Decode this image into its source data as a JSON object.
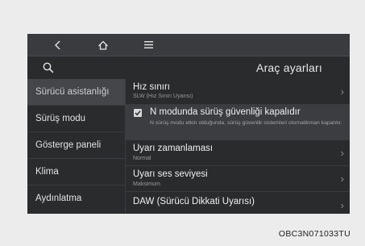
{
  "nav": {
    "back_icon": "chevron-left-icon",
    "home_icon": "home-icon",
    "menu_icon": "menu-icon"
  },
  "header": {
    "search_icon": "search-icon",
    "title": "Araç ayarları"
  },
  "sidebar": {
    "items": [
      {
        "label": "Sürücü asistanlığı",
        "active": true
      },
      {
        "label": "Sürüş modu",
        "active": false
      },
      {
        "label": "Gösterge paneli",
        "active": false
      },
      {
        "label": "Klima",
        "active": false
      },
      {
        "label": "Aydınlatma",
        "active": false
      }
    ]
  },
  "settings": {
    "speed_limit": {
      "label": "Hız sınırı",
      "value": "SLW (Hız Sınırı Uyarısı)"
    },
    "n_mode": {
      "label": "N modunda sürüş güvenliği kapalıdır",
      "checked": true,
      "description": "N sürüş modu etkin olduğunda, sürüş güvenlik sistemleri otomatikman kapatılır."
    },
    "warning_timing": {
      "label": "Uyarı zamanlaması",
      "value": "Normal"
    },
    "warning_volume": {
      "label": "Uyarı ses seviyesi",
      "value": "Maksimum"
    },
    "daw": {
      "label": "DAW (Sürücü Dikkati Uyarısı)"
    }
  },
  "caption": "OBC3N071033TU",
  "colors": {
    "screen_bg": "#2a2b2d",
    "topbar_bg": "#3a3b3e",
    "active_item_bg": "#45464a",
    "text": "#f0f0f0",
    "subtext": "#9a9a9c"
  }
}
